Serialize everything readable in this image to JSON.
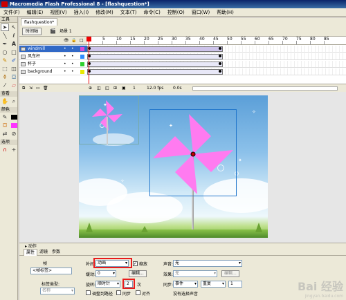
{
  "window": {
    "title": "Macromedia Flash Professional 8 - [flashquestion*]"
  },
  "menu": [
    "文件(F)",
    "编辑(E)",
    "视图(V)",
    "插入(I)",
    "修改(M)",
    "文本(T)",
    "命令(C)",
    "控制(O)",
    "窗口(W)",
    "帮助(H)"
  ],
  "tools": {
    "header": "工具",
    "view_label": "查看",
    "color_label": "颜色",
    "options_label": "选项",
    "icons": [
      "arrow-icon",
      "subselect-icon",
      "line-icon",
      "lasso-icon",
      "pen-icon",
      "text-icon",
      "oval-icon",
      "rect-icon",
      "pencil-icon",
      "brush-icon",
      "freetransform-icon",
      "fill-transform-icon",
      "inkbottle-icon",
      "paintbucket-icon",
      "eyedropper-icon",
      "eraser-icon"
    ]
  },
  "document": {
    "tab": "flashquestion*",
    "timeline_button": "时间轴",
    "scene": "场景 1"
  },
  "timeline": {
    "ruler": [
      "1",
      "5",
      "10",
      "15",
      "20",
      "25",
      "30",
      "35",
      "40",
      "45",
      "50",
      "55",
      "60",
      "65",
      "70",
      "75",
      "80",
      "85"
    ],
    "layers": [
      {
        "name": "windmill",
        "selected": true,
        "color": "#d94bd9",
        "motion": true
      },
      {
        "name": "风车杆",
        "selected": false,
        "color": "#2f8cff",
        "motion": false
      },
      {
        "name": "杯子",
        "selected": false,
        "color": "#2fcf2f",
        "motion": false
      },
      {
        "name": "background",
        "selected": false,
        "color": "#e8e800",
        "motion": false
      }
    ],
    "status": {
      "frame": "1",
      "fps": "12.0 fps",
      "time": "0.0s"
    }
  },
  "stage": {
    "petal_color": "#ff7bf0",
    "pin_color": "#c00000"
  },
  "panels": {
    "actions_label": "动作"
  },
  "properties": {
    "tabs": [
      "属性",
      "滤镜",
      "参数"
    ],
    "frame_label": "帧",
    "frame_name_placeholder": "<帧标签>",
    "label_type_label": "标签类型:",
    "label_type_value": "名称",
    "tween_label": "补间:",
    "tween_value": "动画",
    "scale_label": "缩放",
    "scale_checked": true,
    "ease_label": "缓动:",
    "ease_value": "0",
    "edit_button": "编辑...",
    "rotate_label": "旋转:",
    "rotate_value": "顺时针",
    "rotate_times": "2",
    "times_unit": "次",
    "orient_label": "调整到路径",
    "sync_label": "同步",
    "snap_label": "对齐",
    "sound_label": "声音:",
    "sound_value": "无",
    "effect_label": "效果:",
    "effect_value": "无",
    "edit_button2": "编辑...",
    "sync_label2": "同步:",
    "sync_value": "事件",
    "repeat_value": "重复",
    "repeat_count": "1",
    "no_sound": "没有选择声音"
  },
  "watermark": {
    "brand": "Bai 经验",
    "url": "jingyan.baidu.com"
  }
}
